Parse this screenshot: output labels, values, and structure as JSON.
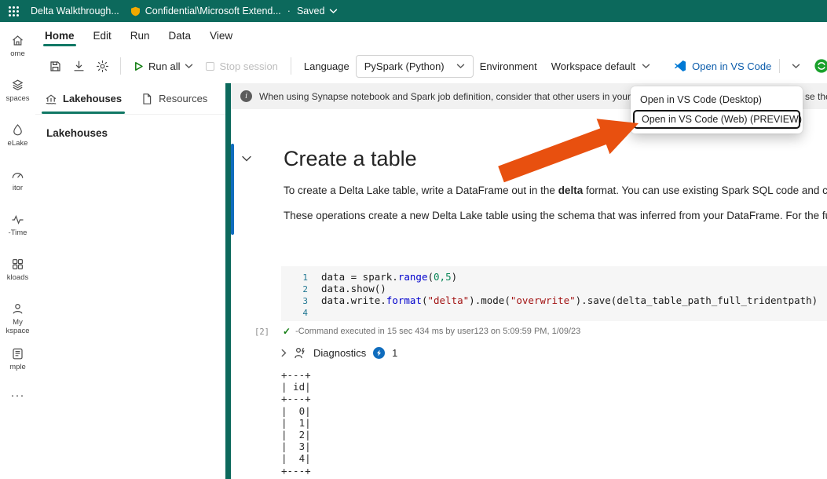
{
  "topbar": {
    "title": "Delta Walkthrough...",
    "sensitivity_label": "Confidential\\Microsoft Extend...",
    "separator_dot": "·",
    "save_status": "Saved"
  },
  "menubar": {
    "items": [
      "Home",
      "Edit",
      "Run",
      "Data",
      "View"
    ]
  },
  "toolbar": {
    "run_all": "Run all",
    "stop_session": "Stop session",
    "language_label": "Language",
    "language_value": "PySpark (Python)",
    "environment_label": "Environment",
    "environment_value": "Workspace default",
    "open_vscode_label": "Open in VS Code"
  },
  "vscode_menu": {
    "items": [
      "Open in VS Code (Desktop)",
      "Open in VS Code (Web) (PREVIEW)"
    ]
  },
  "sidebar": {
    "items": [
      "ome",
      "spaces",
      "eLake",
      "itor",
      "-Time",
      "kloads",
      "My\nkspace",
      "mple",
      "···"
    ]
  },
  "panel": {
    "tab_lakehouses": "Lakehouses",
    "tab_resources": "Resources",
    "collapse": "«",
    "heading": "Lakehouses"
  },
  "banner": {
    "text": "When using Synapse notebook and Spark job definition, consider that other users in your organization",
    "text_right_fragment": "se the"
  },
  "notebook": {
    "heading": "Create a table",
    "p1_before": "To create a Delta Lake table, write a DataFrame out in the ",
    "p1_bold": "delta",
    "p1_after": " format. You can use existing Spark SQL code and chan",
    "p2": "These operations create a new Delta Lake table using the schema that was inferred from your DataFrame. For the full s",
    "code": {
      "nums": [
        "1",
        "2",
        "3",
        "4"
      ],
      "l1": [
        "data = spark.",
        "range",
        "(",
        "0,5",
        ")"
      ],
      "l2": "data.show()",
      "l3": [
        "data.write.",
        "format",
        "(",
        "\"delta\"",
        ").mode(",
        "\"overwrite\"",
        ").save(delta_table_path_full_tridentpath)"
      ]
    },
    "execution_count": "[2]",
    "execution_status": "-Command executed in 15 sec 434 ms by user123 on 5:09:59 PM, 1/09/23",
    "diagnostics_label": "Diagnostics",
    "diagnostics_count": "1",
    "output": "+---+\n| id|\n+---+\n|  0|\n|  1|\n|  2|\n|  3|\n|  4|\n+---+"
  },
  "colors": {
    "topbar_teal": "#0C695C",
    "accent_teal": "#117865",
    "cell_indicator_blue": "#0F6CBD",
    "vscode_blue": "#0B5CAB",
    "arrow_orange": "#E8500F",
    "check_green": "#107C10",
    "badge_blue": "#0F6CBD"
  }
}
